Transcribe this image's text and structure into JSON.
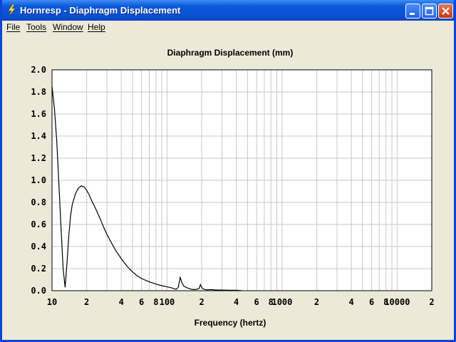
{
  "window": {
    "title": "Hornresp - Diaphragm Displacement"
  },
  "menu": {
    "items": [
      "File",
      "Tools",
      "Window",
      "Help"
    ]
  },
  "colors": {
    "titlebar": "#0b4fd0",
    "plot_background": "#ffffff",
    "grid": "#c8c8c8",
    "curve": "#000000"
  },
  "icons": {
    "app": "lightning-icon",
    "minimize": "minimize-icon",
    "maximize": "maximize-icon",
    "close": "close-icon"
  },
  "chart_data": {
    "type": "line",
    "title": "Diaphragm Displacement (mm)",
    "xlabel": "Frequency (hertz)",
    "ylabel": "",
    "x_scale": "log",
    "xlim": [
      10,
      20000
    ],
    "ylim": [
      0,
      2.0
    ],
    "grid": true,
    "legend": "none",
    "x_tick_labels": [
      "10",
      "2",
      "4",
      "6",
      "8",
      "100",
      "2",
      "4",
      "6",
      "8",
      "1000",
      "2",
      "4",
      "6",
      "8",
      "10000",
      "2"
    ],
    "x_tick_values": [
      10,
      20,
      40,
      60,
      80,
      100,
      200,
      400,
      600,
      800,
      1000,
      2000,
      4000,
      6000,
      8000,
      10000,
      20000
    ],
    "y_tick_labels": [
      "2.0",
      "1.8",
      "1.6",
      "1.4",
      "1.2",
      "1.0",
      "0.8",
      "0.6",
      "0.4",
      "0.2",
      "0.0"
    ],
    "y_tick_values": [
      2.0,
      1.8,
      1.6,
      1.4,
      1.2,
      1.0,
      0.8,
      0.6,
      0.4,
      0.2,
      0.0
    ],
    "series": [
      {
        "x": [
          10,
          10.5,
          11,
          11.5,
          12,
          12.5,
          13,
          13.5,
          14,
          14.5,
          15,
          16,
          17,
          18,
          19,
          20,
          21,
          22,
          24,
          26,
          28,
          30,
          33,
          36,
          40,
          45,
          50,
          55,
          60,
          70,
          80,
          90,
          100,
          110,
          115,
          120,
          125,
          130,
          135,
          140,
          150,
          160,
          170,
          180,
          190,
          195,
          200,
          205,
          210,
          220,
          240,
          260,
          280,
          300,
          350,
          400,
          450
        ],
        "y": [
          1.85,
          1.65,
          1.35,
          0.95,
          0.55,
          0.2,
          0.03,
          0.25,
          0.5,
          0.68,
          0.78,
          0.88,
          0.93,
          0.95,
          0.94,
          0.91,
          0.87,
          0.82,
          0.74,
          0.66,
          0.58,
          0.51,
          0.43,
          0.36,
          0.29,
          0.22,
          0.17,
          0.135,
          0.11,
          0.08,
          0.06,
          0.045,
          0.035,
          0.025,
          0.018,
          0.012,
          0.03,
          0.12,
          0.07,
          0.04,
          0.025,
          0.015,
          0.01,
          0.012,
          0.02,
          0.055,
          0.03,
          0.018,
          0.012,
          0.008,
          0.01,
          0.007,
          0.006,
          0.006,
          0.004,
          0.004,
          0.0
        ]
      }
    ]
  }
}
